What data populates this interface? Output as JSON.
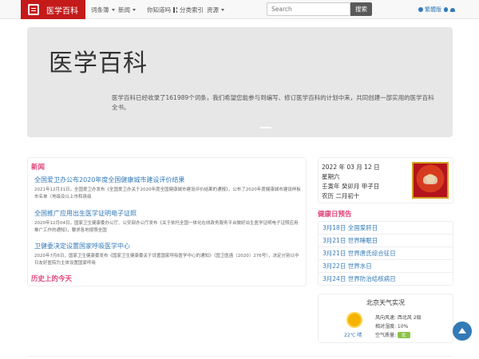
{
  "navbar": {
    "brand": "医学百科",
    "items": [
      {
        "label": "词条簿",
        "has_caret": true
      },
      {
        "label": "新闻",
        "has_caret": true
      },
      {
        "label": "你知道吗",
        "has_caret": false
      },
      {
        "label": "分类索引",
        "has_caret": false
      },
      {
        "label": "资源",
        "has_caret": true
      }
    ],
    "search_placeholder": "Search",
    "search_button": "搜索",
    "lang_label": "繁體版"
  },
  "jumbotron": {
    "title": "医学百科",
    "text": "医学百科已经收录了161989个词条，我们希望您能参与到编写、修订医学百科的计划中来，共同创建一部实用的医学百科全书。"
  },
  "news": {
    "title": "新闻",
    "items": [
      {
        "title": "全国爱卫办公布2020年度全国健康城市建设评价结果",
        "desc": "2021年12月31日，全国爱卫办发布《全国爱卫办关于2020年度全国健康城市建设评价结果的通报》，公布了2020年度健康城市建设样板市名单（地级及以上市和县级"
      },
      {
        "title": "全国推广应用出生医学证明电子证照",
        "desc": "2020年12月04日，国家卫生健康委办公厅、公安部办公厅发布《关于依托全国一体化在线政务服务平台做好出生医学证明电子证照应用推广工作的通知》，要求各地按照全国"
      },
      {
        "title": "卫健委决定设置国家呼吸医学中心",
        "desc": "2020年7月6日，国家卫生健康委发布《国家卫生健康委关于设置国家呼吸医学中心的通知》（国卫医函〔2020〕276号），决定分别以中日友好医院为主体设置国家呼吸"
      }
    ],
    "today_title": "历史上的今天"
  },
  "date": {
    "line1": "2022 年 03 月 12 日",
    "line2": "星期六",
    "line3": "壬寅年 癸卯月 甲子日",
    "line4": "农历 二月初十"
  },
  "health": {
    "title": "健康日预告",
    "items": [
      "3月18日 全国爱肝日",
      "3月21日 世界睡眠日",
      "3月21日 世界唐氏综合征日",
      "3月22日 世界水日",
      "3月24日 世界防治结核病日"
    ]
  },
  "weather": {
    "title": "北京天气实况",
    "temp": "22℃ 晴",
    "wind": "风向风速: 西北风 2级",
    "humidity": "相对湿度: 10%",
    "aqi_label": "空气质量:",
    "aqi_value": "优",
    "aqi_color": "#8bc34a"
  },
  "colors": {
    "brand": "#c41a1a",
    "accent": "#e0457b",
    "link": "#337ab7"
  }
}
